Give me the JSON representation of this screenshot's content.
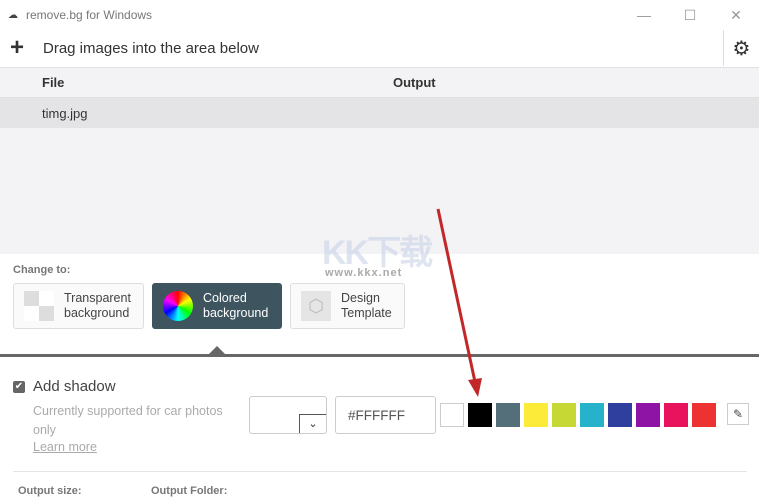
{
  "window": {
    "title": "remove.bg for Windows",
    "controls": [
      "minimize",
      "maximize",
      "close"
    ]
  },
  "toolbar": {
    "add_icon": "plus-icon",
    "hint": "Drag images into the area below",
    "settings_icon": "gear-icon"
  },
  "file_list": {
    "columns": [
      "File",
      "Output"
    ],
    "rows": [
      {
        "file": "timg.jpg",
        "output": ""
      }
    ]
  },
  "change_to": {
    "label": "Change to:",
    "options": [
      {
        "label1": "Transparent",
        "label2": "background",
        "icon": "checkerboard-icon",
        "active": false
      },
      {
        "label1": "Colored",
        "label2": "background",
        "icon": "color-wheel-icon",
        "active": true
      },
      {
        "label1": "Design",
        "label2": "Template",
        "icon": "cube-icon",
        "active": false
      }
    ]
  },
  "shadow": {
    "checked": true,
    "label": "Add shadow",
    "note": "Currently supported for car photos only",
    "learn_more": "Learn more"
  },
  "color": {
    "hex_value": "#FFFFFF",
    "swatches": [
      "#FFFFFF",
      "#000000",
      "#546E7A",
      "#FDEB3A",
      "#C5D833",
      "#27B2CC",
      "#2F3F9E",
      "#8E14A6",
      "#E8135C",
      "#EC3331"
    ],
    "eyedropper_icon": "eyedropper-icon"
  },
  "footer": {
    "output_size": "Output size:",
    "output_folder": "Output Folder:"
  },
  "watermark": {
    "text": "KK下载",
    "url": "www.kkx.net"
  }
}
